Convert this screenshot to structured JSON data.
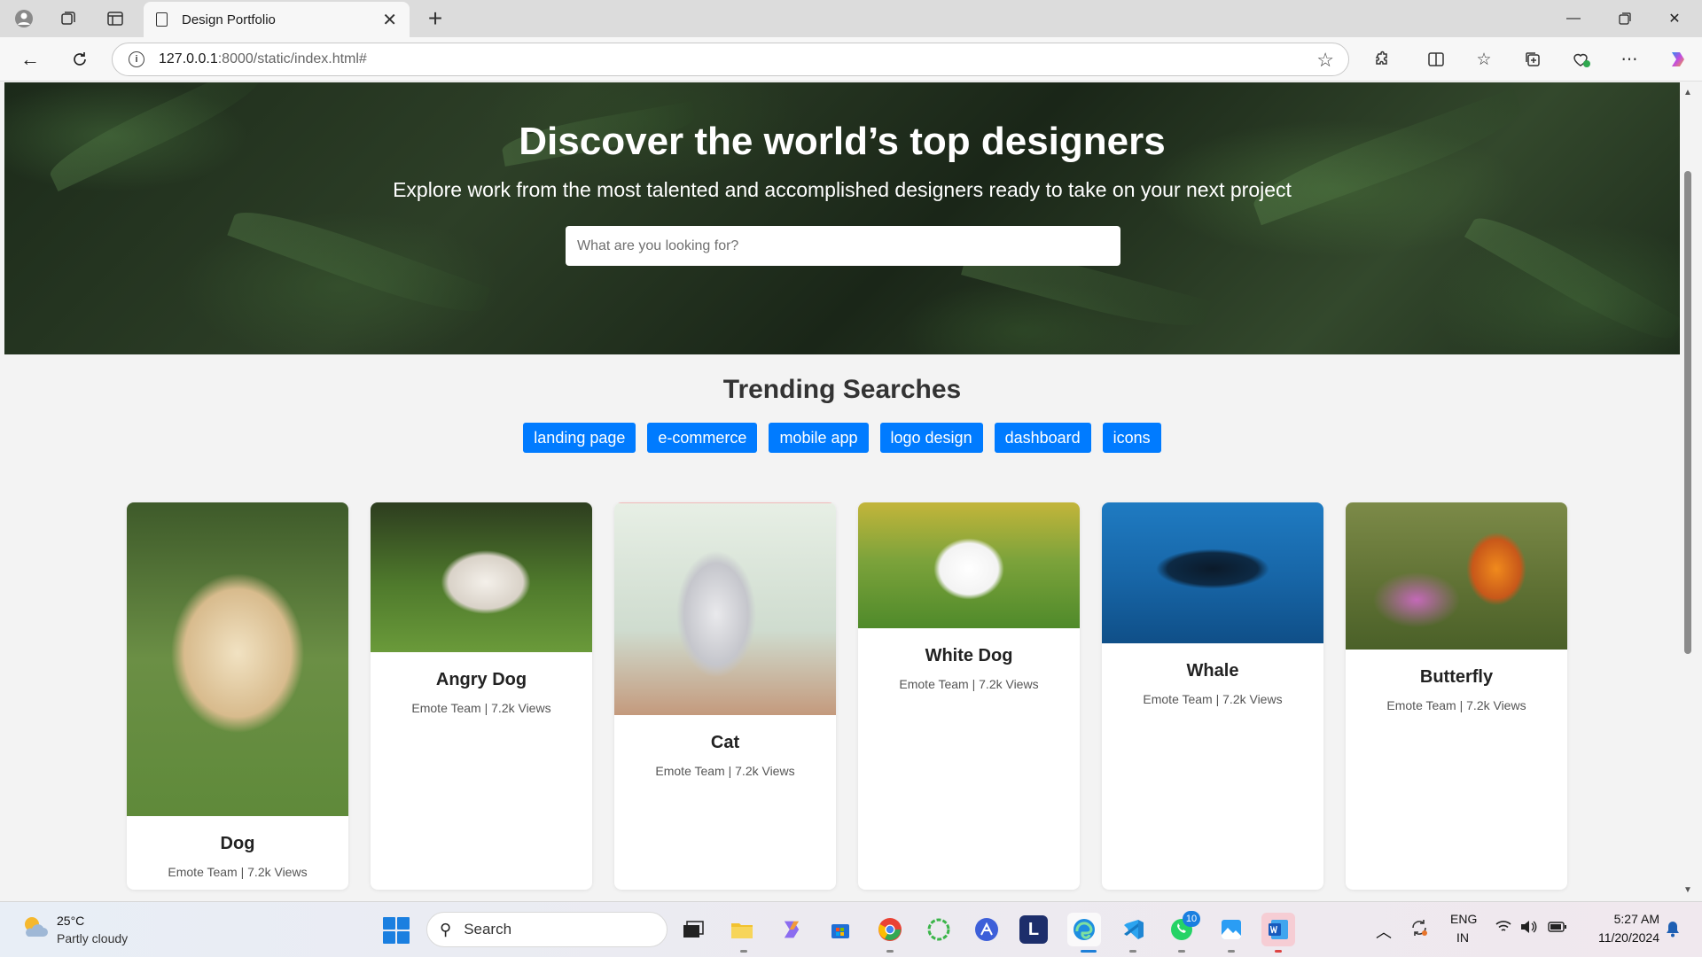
{
  "browser": {
    "tab_title": "Design Portfolio",
    "url_host": "127.0.0.1",
    "url_path": ":8000/static/index.html#"
  },
  "hero": {
    "title": "Discover the world’s top designers",
    "subtitle": "Explore work from the most talented and accomplished designers ready to take on your next project",
    "search_placeholder": "What are you looking for?"
  },
  "trending": {
    "title": "Trending Searches",
    "tags": [
      "landing page",
      "e-commerce",
      "mobile app",
      "logo design",
      "dashboard",
      "icons"
    ]
  },
  "cards": [
    {
      "title": "Dog",
      "meta": "Emote Team | 7.2k Views"
    },
    {
      "title": "Angry Dog",
      "meta": "Emote Team | 7.2k Views"
    },
    {
      "title": "Cat",
      "meta": "Emote Team | 7.2k Views"
    },
    {
      "title": "White Dog",
      "meta": "Emote Team | 7.2k Views"
    },
    {
      "title": "Whale",
      "meta": "Emote Team | 7.2k Views"
    },
    {
      "title": "Butterfly",
      "meta": "Emote Team | 7.2k Views"
    }
  ],
  "taskbar": {
    "weather_temp": "25°C",
    "weather_desc": "Partly cloudy",
    "search_label": "Search",
    "lang_top": "ENG",
    "lang_bottom": "IN",
    "time": "5:27 AM",
    "date": "11/20/2024",
    "whatsapp_badge": "10",
    "apps": [
      "task-view",
      "file-explorer",
      "copilot",
      "microsoft-store",
      "chrome",
      "app-circle",
      "app-a",
      "app-l",
      "edge",
      "vscode",
      "whatsapp",
      "photos",
      "word"
    ]
  },
  "colors": {
    "accent": "#007bff",
    "tag_text": "#ffffff",
    "page_bg": "#f3f3f3"
  }
}
